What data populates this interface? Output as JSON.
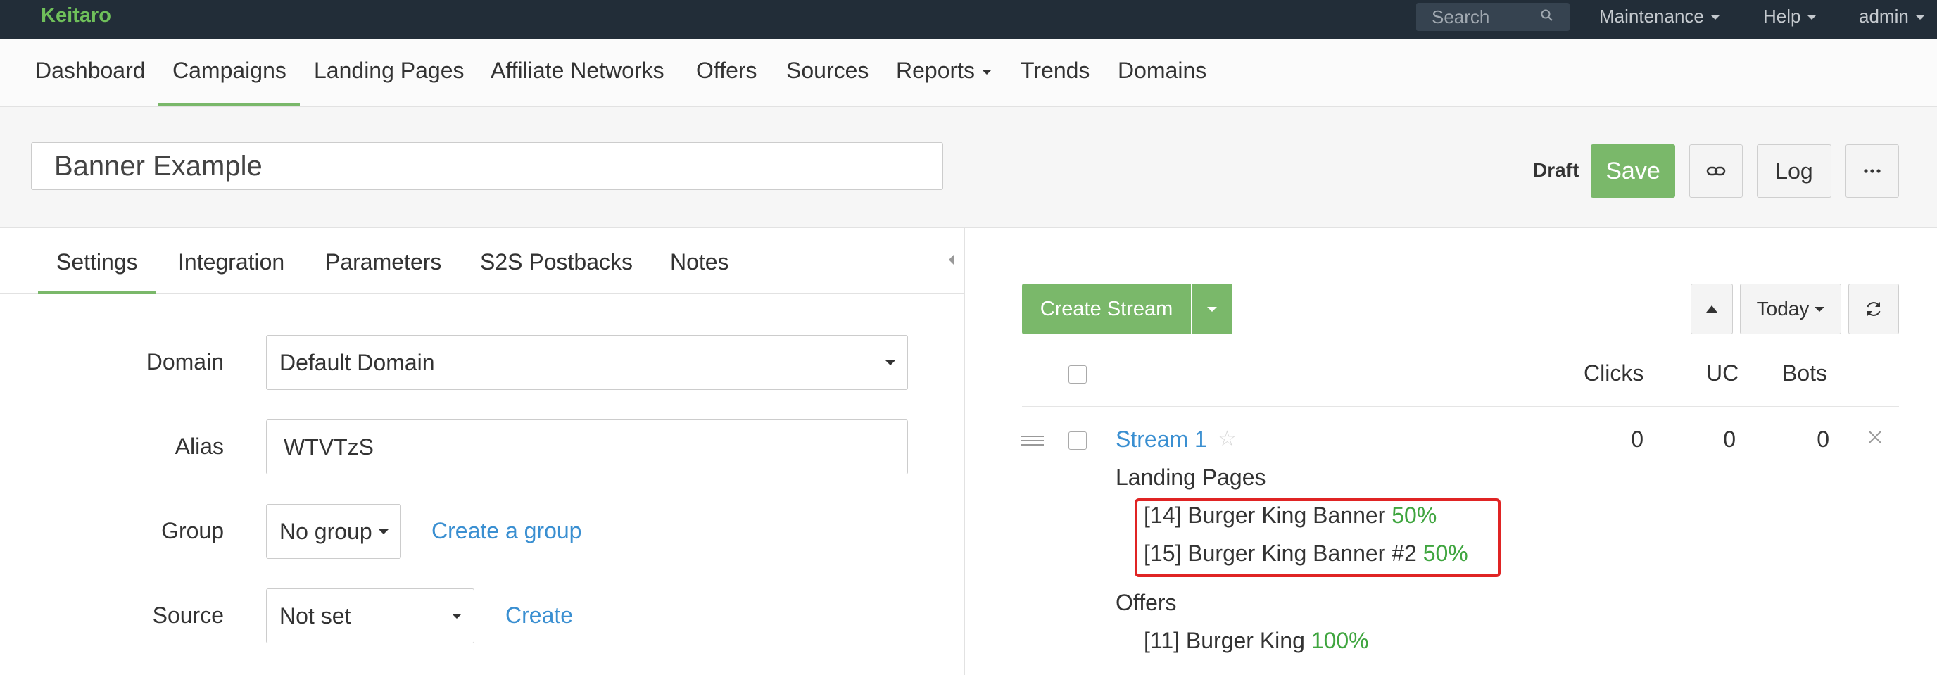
{
  "topbar": {
    "brand": "Keitaro",
    "search_placeholder": "Search",
    "menus": [
      "Maintenance",
      "Help",
      "admin"
    ]
  },
  "nav": {
    "items": [
      "Dashboard",
      "Campaigns",
      "Landing Pages",
      "Affiliate Networks",
      "Offers",
      "Sources",
      "Reports",
      "Trends",
      "Domains"
    ],
    "active": "Campaigns"
  },
  "campaign": {
    "name": "Banner Example",
    "status": "Draft",
    "save_label": "Save",
    "log_label": "Log"
  },
  "tabs": {
    "items": [
      "Settings",
      "Integration",
      "Parameters",
      "S2S Postbacks",
      "Notes"
    ],
    "active": "Settings"
  },
  "form": {
    "domain": {
      "label": "Domain",
      "value": "Default Domain"
    },
    "alias": {
      "label": "Alias",
      "value": "WTVTzS"
    },
    "group": {
      "label": "Group",
      "value": "No group",
      "link": "Create a group"
    },
    "source": {
      "label": "Source",
      "value": "Not set",
      "link": "Create"
    }
  },
  "streams": {
    "create_label": "Create Stream",
    "period": "Today",
    "columns": [
      "Clicks",
      "UC",
      "Bots"
    ],
    "rows": [
      {
        "name": "Stream 1",
        "clicks": "0",
        "uc": "0",
        "bots": "0",
        "landing_pages_title": "Landing Pages",
        "landing_pages": [
          {
            "label": "[14] Burger King Banner",
            "share": "50%"
          },
          {
            "label": "[15] Burger King Banner #2",
            "share": "50%"
          }
        ],
        "offers_title": "Offers",
        "offers": [
          {
            "label": "[11] Burger King",
            "share": "100%"
          }
        ]
      }
    ]
  },
  "colors": {
    "topbar_bg": "#222d38",
    "brand": "#6fbf5a",
    "accent_green": "#7ab86a",
    "link_blue": "#3a8fd1",
    "percent_green": "#3fa53f",
    "highlight_red": "#e02424"
  }
}
